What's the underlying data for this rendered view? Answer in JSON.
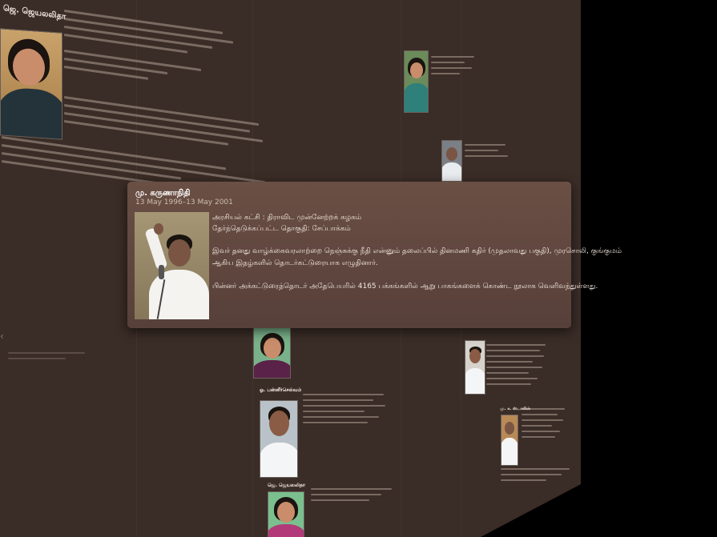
{
  "focus_card": {
    "name": "மு. கருணாநிதி",
    "date": "13 May 1996–13 May 2001",
    "party": "அரசியல் கட்சி : திராவிட முன்னேற்றக் கழகம்",
    "constituency": "தேர்ந்தெடுக்கப்பட்ட தொகுதி: சேப்பாக்கம்",
    "desc_line1": "இவர் தனது வாழ்க்கைவரலாற்றை நெஞ்சுக்கு நீதி என்னும் தலைப்பில் தினமணி கதிர் (முதலாவது பகுதி), முரசொலி, குங்குமம்",
    "desc_line2": "ஆகிய இதழ்களில் தொடர்கட்டுரையாக எழுதினார்.",
    "desc_line3": "பின்னர் அக்கட்டுரைத்தொடர் அதேபெயரில் 4165 பக்கங்களில் ஆறு பாகங்களைக் கொண்ட நூலாக வெளிவந்துள்ளது."
  },
  "background_cards": [
    {
      "title": "ஜெ. ஜெயலலிதா"
    },
    {
      "title": "ஓ. பன்னீர்செல்வம்"
    },
    {
      "title": "மு. க. ஸ்டாலின்"
    }
  ],
  "colors": {
    "wall": "#3a2c26",
    "card_bg": "#6a4f44",
    "text": "#f2e8df"
  },
  "icons": {
    "left_arrow": "chevron-left-icon"
  }
}
